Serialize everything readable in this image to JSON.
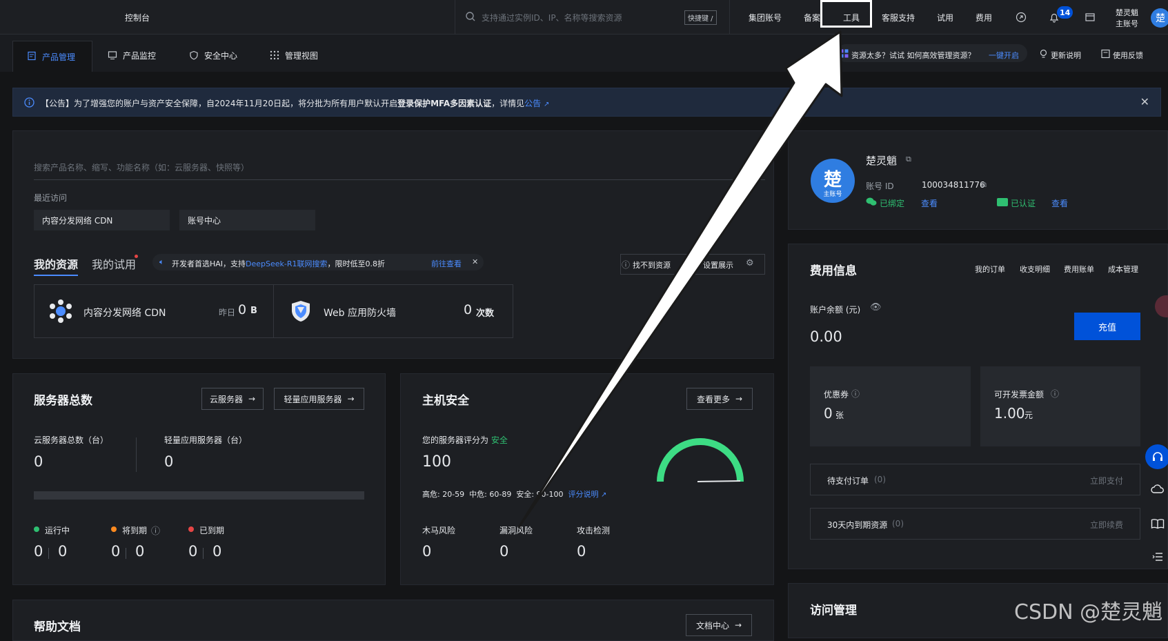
{
  "topbar": {
    "console": "控制台",
    "search_placeholder": "支持通过实例ID、IP、名称等搜索资源",
    "shortcut": "快捷键 /",
    "nav": [
      "集团账号",
      "备案",
      "工具",
      "客服支持",
      "试用",
      "费用"
    ],
    "notif_count": "14",
    "user_line1": "楚灵魈",
    "user_line2": "主账号",
    "avatar": "楚"
  },
  "tabs": {
    "items": [
      "产品管理",
      "产品监控",
      "安全中心",
      "管理视图"
    ],
    "promo_text": "资源太多？试试 如何高效管理资源？",
    "promo_link": "一键开启",
    "updates": "更新说明",
    "feedback": "使用反馈"
  },
  "notice": {
    "text_prefix": "【公告】为了增强您的账户与资产安全保障，自2024年11月20日起，将分批为所有用户默认开启",
    "text_bold": "登录保护MFA多因素认证",
    "text_suffix": "，详情见",
    "link": "公告"
  },
  "products": {
    "search_placeholder": "搜索产品名称、缩写、功能名称（如：云服务器、快照等）",
    "recent_label": "最近访问",
    "recent": [
      "内容分发网络 CDN",
      "账号中心"
    ],
    "tab_resources": "我的资源",
    "tab_trial": "我的试用",
    "promo_text": "开发者首选HAI，支持",
    "promo_highlight": "DeepSeek-R1联网搜索",
    "promo_suffix": "，限时低至0.8折",
    "promo_link": "前往查看",
    "not_found": "找不到资源",
    "display_settings": "设置展示",
    "cards": [
      {
        "name": "内容分发网络 CDN",
        "sub": "昨日",
        "value": "0",
        "unit": "B"
      },
      {
        "name": "Web 应用防火墙",
        "sub": "",
        "value": "0",
        "unit": "次数"
      }
    ]
  },
  "servers": {
    "title": "服务器总数",
    "btn_cvm": "云服务器",
    "btn_light": "轻量应用服务器",
    "cvm_label": "云服务器总数（台）",
    "cvm_value": "0",
    "light_label": "轻量应用服务器（台）",
    "light_value": "0",
    "statuses": [
      {
        "label": "运行中",
        "color": "#2fbf71",
        "a": "0",
        "b": "0"
      },
      {
        "label": "将到期",
        "color": "#ff8a1f",
        "a": "0",
        "b": "0"
      },
      {
        "label": "已到期",
        "color": "#e54545",
        "a": "0",
        "b": "0"
      }
    ]
  },
  "host_security": {
    "title": "主机安全",
    "more": "查看更多",
    "score_label": "您的服务器评分为",
    "score_state": "安全",
    "score": "100",
    "score_ranges": "高危: 20-59  中危: 60-89  安全: 90-100",
    "score_link": "评分说明",
    "gauge_color": "#3ddc84",
    "risks": [
      {
        "label": "木马风险",
        "value": "0"
      },
      {
        "label": "漏洞风险",
        "value": "0"
      },
      {
        "label": "攻击检测",
        "value": "0"
      }
    ]
  },
  "help": {
    "title": "帮助文档",
    "btn": "文档中心"
  },
  "account": {
    "avatar": "楚",
    "avatar_sub": "主账号",
    "name": "楚灵魈",
    "id_label": "账号 ID",
    "id_value": "100034811776",
    "wechat": "已绑定",
    "wechat_view": "查看",
    "verified": "已认证",
    "verified_view": "查看"
  },
  "billing": {
    "title": "费用信息",
    "links": [
      "我的订单",
      "收支明细",
      "费用账单",
      "成本管理"
    ],
    "balance_label": "账户余额 (元)",
    "balance": "0.00",
    "recharge": "充值",
    "coupon_label": "优惠券",
    "coupon_value": "0",
    "coupon_unit": "张",
    "invoice_label": "可开发票金额",
    "invoice_value": "1.00",
    "invoice_unit": "元",
    "pending_label": "待支付订单",
    "pending_count": "(0)",
    "pending_action": "立即支付",
    "expiring_label": "30天内到期资源",
    "expiring_count": "(0)",
    "expiring_action": "立即续费"
  },
  "access": {
    "title": "访问管理"
  },
  "watermark": "CSDN @楚灵魈",
  "accent": "#0052d9"
}
